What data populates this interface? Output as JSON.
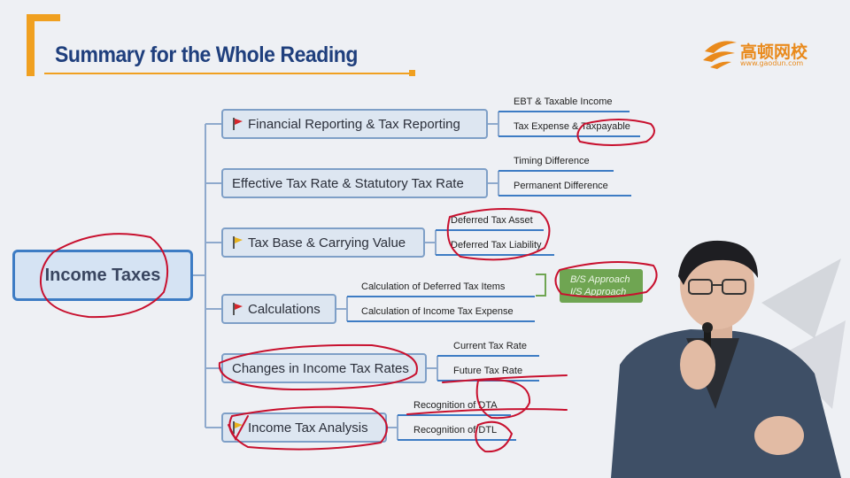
{
  "header": {
    "title": "Summary for the Whole Reading"
  },
  "logo": {
    "brand_cn": "高顿网校",
    "url_text": "www.gaodun.com"
  },
  "root": {
    "label": "Income Taxes"
  },
  "branches": [
    {
      "label": "Financial Reporting & Tax Reporting",
      "flag": "red",
      "leaves": [
        "EBT & Taxable Income",
        "Tax Expense & Taxpayable"
      ]
    },
    {
      "label": "Effective Tax Rate & Statutory Tax Rate",
      "flag": "",
      "leaves": [
        "Timing Difference",
        "Permanent Difference"
      ]
    },
    {
      "label": "Tax Base & Carrying Value",
      "flag": "yellow",
      "leaves": [
        "Deferred Tax Asset",
        "Deferred Tax Liability"
      ]
    },
    {
      "label": "Calculations",
      "flag": "red",
      "leaves": [
        "Calculation of Deferred Tax Items",
        "Calculation of Income Tax Expense"
      ]
    },
    {
      "label": "Changes in Income Tax Rates",
      "flag": "",
      "leaves": [
        "Current Tax Rate",
        "Future Tax Rate"
      ]
    },
    {
      "label": "Income Tax Analysis",
      "flag": "yellow",
      "leaves": [
        "Recognition of DTA",
        "Recognition of DTL"
      ]
    }
  ],
  "approach": {
    "line1": "B/S Approach",
    "line2": "I/S Approach"
  },
  "colors": {
    "accent": "#f0a020",
    "title": "#1f3f7d",
    "node_border": "#3d7cc4",
    "annotation_ink": "#c8102e",
    "approach_green": "#6fa552"
  }
}
